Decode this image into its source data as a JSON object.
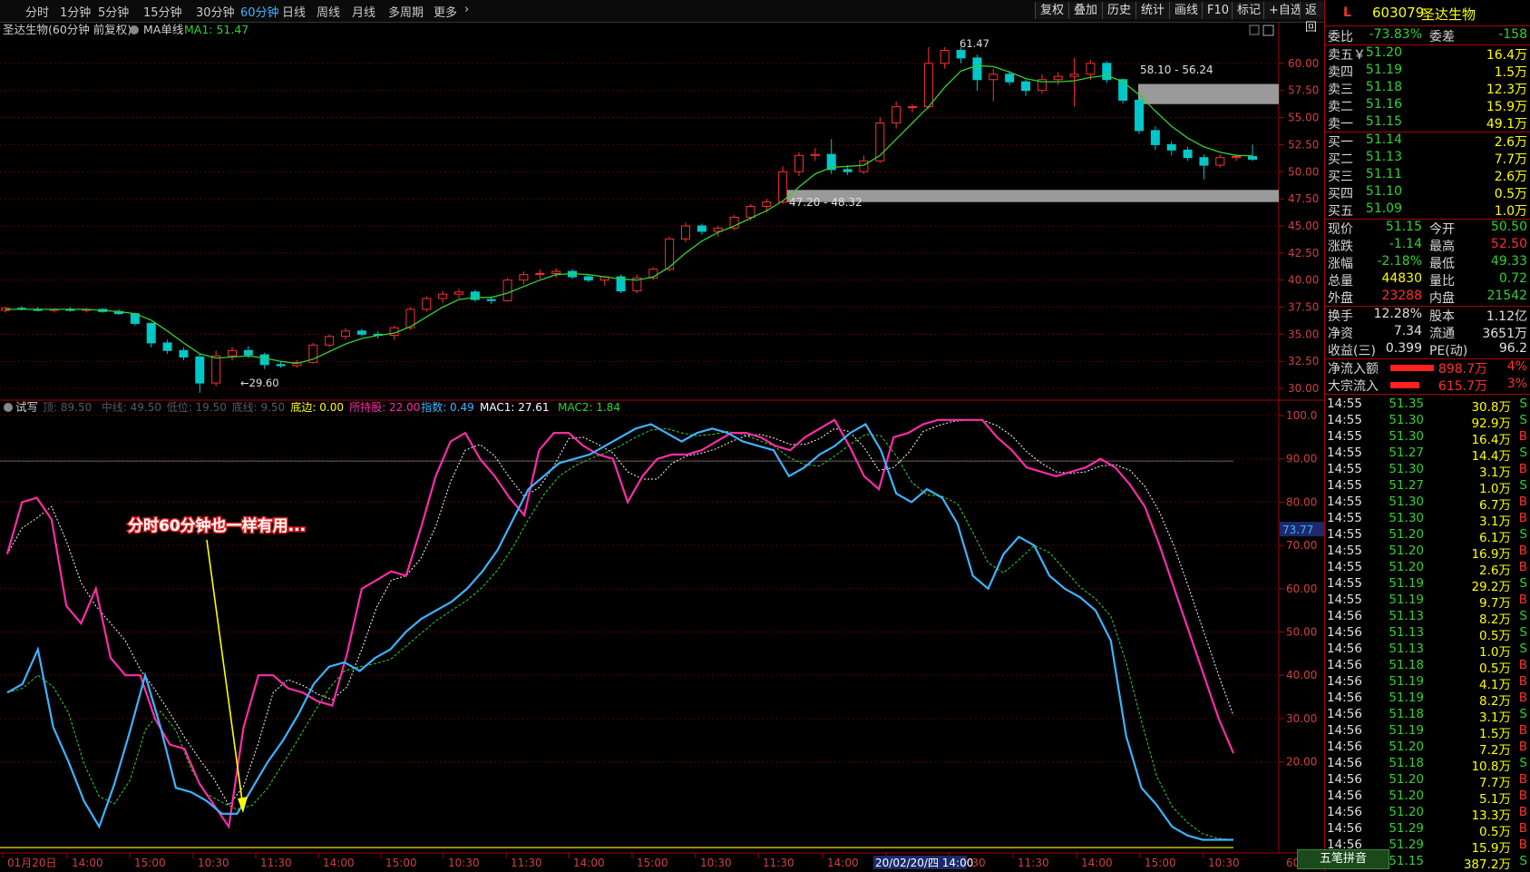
{
  "toolbar": {
    "periods": [
      "分时",
      "1分钟",
      "5分钟",
      "15分钟",
      "30分钟",
      "60分钟",
      "日线",
      "周线",
      "月线",
      "多周期",
      "更多"
    ],
    "active_period": "60分钟",
    "more_arrow": "›",
    "buttons": [
      "复权",
      "叠加",
      "历史",
      "统计",
      "画线",
      "F10",
      "标记",
      "+自选",
      "返回"
    ]
  },
  "main_chart": {
    "title": "圣达生物(60分钟 前复权)",
    "ma_label": "MA单线",
    "ma_value": "MA1: 51.47",
    "price_ticks": [
      "60.00",
      "57.50",
      "55.00",
      "52.50",
      "50.00",
      "47.50",
      "45.00",
      "42.50",
      "40.00",
      "37.50",
      "35.00",
      "32.50",
      "30.00"
    ],
    "high_label": "61.47",
    "low_label": "29.60",
    "zone_upper_label": "58.10 - 56.24",
    "zone_lower_label": "47.20 - 48.32"
  },
  "indicator": {
    "name": "试写",
    "legend": [
      {
        "label": "顶: 89.50",
        "color": "#5a5a5a"
      },
      {
        "label": "中线: 49.50",
        "color": "#5a5a5a"
      },
      {
        "label": "低位: 19.50",
        "color": "#5a5a5a"
      },
      {
        "label": "底线: 9.50",
        "color": "#5a5a5a"
      },
      {
        "label": "底边: 0.00",
        "color": "#ffff00"
      },
      {
        "label": "所持股: 22.00",
        "color": "#ff2ca8"
      },
      {
        "label": "指数: 0.49",
        "color": "#3db4ff"
      },
      {
        "label": "MAC1: 27.61",
        "color": "#ffffff"
      },
      {
        "label": "MAC2: 1.84",
        "color": "#32d232"
      }
    ],
    "ticks": [
      "100.0",
      "90.00",
      "80.00",
      "70.00",
      "60.00",
      "50.00",
      "40.00",
      "30.00",
      "20.00"
    ],
    "current_marker": "73.77",
    "annotation": "分时60分钟也一样有用..."
  },
  "time_axis": {
    "labels": [
      "01月20日",
      "14:00",
      "15:00",
      "10:30",
      "11:30",
      "14:00",
      "15:00",
      "10:30",
      "11:30",
      "14:00",
      "15:00",
      "10:30",
      "11:30",
      "14:00",
      "15:00",
      "10:30",
      "11:30",
      "14:00",
      "15:00",
      "10:30"
    ],
    "cursor_label": "20/02/20/四 14:00",
    "right_label": "60"
  },
  "quote": {
    "logo": "L",
    "code": "603079",
    "name": "圣达生物",
    "weibi_label": "委比",
    "weibi": "-73.83%",
    "weicha_label": "委差",
    "weicha": "-158",
    "asks": [
      {
        "label": "卖五￥",
        "price": "51.20",
        "vol": "16.4万"
      },
      {
        "label": "卖四",
        "price": "51.19",
        "vol": "1.5万"
      },
      {
        "label": "卖三",
        "price": "51.18",
        "vol": "12.3万"
      },
      {
        "label": "卖二",
        "price": "51.16",
        "vol": "15.9万"
      },
      {
        "label": "卖一",
        "price": "51.15",
        "vol": "49.1万"
      }
    ],
    "bids": [
      {
        "label": "买一",
        "price": "51.14",
        "vol": "2.6万"
      },
      {
        "label": "买二",
        "price": "51.13",
        "vol": "7.7万"
      },
      {
        "label": "买三",
        "price": "51.11",
        "vol": "2.6万"
      },
      {
        "label": "买四",
        "price": "51.10",
        "vol": "0.5万"
      },
      {
        "label": "买五",
        "price": "51.09",
        "vol": "1.0万"
      }
    ],
    "stats": [
      {
        "l1": "现价",
        "v1": "51.15",
        "c1": "g",
        "l2": "今开",
        "v2": "50.50",
        "c2": "g"
      },
      {
        "l1": "涨跌",
        "v1": "-1.14",
        "c1": "g",
        "l2": "最高",
        "v2": "52.50",
        "c2": "r"
      },
      {
        "l1": "涨幅",
        "v1": "-2.18%",
        "c1": "g",
        "l2": "最低",
        "v2": "49.33",
        "c2": "g"
      },
      {
        "l1": "总量",
        "v1": "44830",
        "c1": "y",
        "l2": "量比",
        "v2": "0.72",
        "c2": "g"
      },
      {
        "l1": "外盘",
        "v1": "23288",
        "c1": "r",
        "l2": "内盘",
        "v2": "21542",
        "c2": "g"
      }
    ],
    "stats2": [
      {
        "l1": "换手",
        "v1": "12.28%",
        "c1": "w",
        "l2": "股本",
        "v2": "1.12亿",
        "c2": "w"
      },
      {
        "l1": "净资",
        "v1": "7.34",
        "c1": "w",
        "l2": "流通",
        "v2": "3651万",
        "c2": "w"
      },
      {
        "l1": "收益(三)",
        "v1": "0.399",
        "c1": "w",
        "l2": "PE(动)",
        "v2": "96.2",
        "c2": "w"
      }
    ],
    "flows": [
      {
        "label": "净流入额",
        "value": "898.7万",
        "pct": "4%"
      },
      {
        "label": "大宗流入",
        "value": "615.7万",
        "pct": "3%"
      }
    ]
  },
  "ticks_list": [
    {
      "t": "14:55",
      "p": "51.35",
      "v": "30.8万",
      "s": "S"
    },
    {
      "t": "14:55",
      "p": "51.30",
      "v": "92.9万",
      "s": "S"
    },
    {
      "t": "14:55",
      "p": "51.30",
      "v": "16.4万",
      "s": "B"
    },
    {
      "t": "14:55",
      "p": "51.27",
      "v": "14.4万",
      "s": "S"
    },
    {
      "t": "14:55",
      "p": "51.30",
      "v": "3.1万",
      "s": "B"
    },
    {
      "t": "14:55",
      "p": "51.27",
      "v": "1.0万",
      "s": "S"
    },
    {
      "t": "14:55",
      "p": "51.30",
      "v": "6.7万",
      "s": "B"
    },
    {
      "t": "14:55",
      "p": "51.30",
      "v": "3.1万",
      "s": "B"
    },
    {
      "t": "14:55",
      "p": "51.20",
      "v": "6.1万",
      "s": "S"
    },
    {
      "t": "14:55",
      "p": "51.20",
      "v": "16.9万",
      "s": "B"
    },
    {
      "t": "14:55",
      "p": "51.20",
      "v": "2.6万",
      "s": "B"
    },
    {
      "t": "14:55",
      "p": "51.19",
      "v": "29.2万",
      "s": "S"
    },
    {
      "t": "14:55",
      "p": "51.19",
      "v": "9.7万",
      "s": "B"
    },
    {
      "t": "14:56",
      "p": "51.13",
      "v": "8.2万",
      "s": "S"
    },
    {
      "t": "14:56",
      "p": "51.13",
      "v": "0.5万",
      "s": "S"
    },
    {
      "t": "14:56",
      "p": "51.13",
      "v": "1.0万",
      "s": "S"
    },
    {
      "t": "14:56",
      "p": "51.18",
      "v": "0.5万",
      "s": "B"
    },
    {
      "t": "14:56",
      "p": "51.19",
      "v": "4.1万",
      "s": "B"
    },
    {
      "t": "14:56",
      "p": "51.19",
      "v": "8.2万",
      "s": "B"
    },
    {
      "t": "14:56",
      "p": "51.18",
      "v": "3.1万",
      "s": "S"
    },
    {
      "t": "14:56",
      "p": "51.19",
      "v": "1.5万",
      "s": "B"
    },
    {
      "t": "14:56",
      "p": "51.20",
      "v": "7.2万",
      "s": "B"
    },
    {
      "t": "14:56",
      "p": "51.18",
      "v": "10.8万",
      "s": "S"
    },
    {
      "t": "14:56",
      "p": "51.20",
      "v": "7.7万",
      "s": "B"
    },
    {
      "t": "14:56",
      "p": "51.20",
      "v": "5.1万",
      "s": "B"
    },
    {
      "t": "14:56",
      "p": "51.20",
      "v": "13.3万",
      "s": "B"
    },
    {
      "t": "14:56",
      "p": "51.29",
      "v": "0.5万",
      "s": "B"
    },
    {
      "t": "14:56",
      "p": "51.29",
      "v": "15.9万",
      "s": "B"
    },
    {
      "t": "14:56",
      "p": "51.15",
      "v": "387.2万",
      "s": "S"
    }
  ],
  "bottom_button": "五笔拼音",
  "chart_data": {
    "type": "candlestick",
    "candles": [
      [
        37.2,
        37.5,
        37.0,
        37.4
      ],
      [
        37.4,
        37.6,
        37.2,
        37.3
      ],
      [
        37.3,
        37.5,
        37.1,
        37.2
      ],
      [
        37.2,
        37.4,
        37.0,
        37.3
      ],
      [
        37.3,
        37.5,
        37.1,
        37.2
      ],
      [
        37.2,
        37.4,
        37.0,
        37.3
      ],
      [
        37.3,
        37.4,
        37.0,
        37.1
      ],
      [
        37.1,
        37.3,
        36.8,
        36.9
      ],
      [
        36.9,
        37.0,
        35.8,
        36.0
      ],
      [
        36.0,
        36.1,
        33.8,
        34.2
      ],
      [
        34.2,
        34.5,
        33.2,
        33.5
      ],
      [
        33.5,
        33.8,
        32.6,
        32.9
      ],
      [
        32.9,
        33.2,
        29.6,
        30.5
      ],
      [
        30.5,
        33.5,
        30.2,
        33.0
      ],
      [
        33.0,
        33.8,
        32.6,
        33.5
      ],
      [
        33.5,
        33.9,
        32.8,
        33.1
      ],
      [
        33.1,
        33.3,
        31.8,
        32.2
      ],
      [
        32.2,
        32.5,
        31.9,
        32.1
      ],
      [
        32.1,
        32.6,
        31.9,
        32.4
      ],
      [
        32.4,
        34.2,
        32.3,
        34.0
      ],
      [
        34.0,
        35.0,
        33.8,
        34.8
      ],
      [
        34.8,
        35.6,
        34.5,
        35.3
      ],
      [
        35.3,
        35.5,
        34.8,
        35.0
      ],
      [
        35.0,
        35.3,
        34.6,
        34.9
      ],
      [
        34.9,
        35.8,
        34.5,
        35.6
      ],
      [
        35.6,
        37.5,
        35.4,
        37.3
      ],
      [
        37.3,
        38.5,
        37.1,
        38.3
      ],
      [
        38.3,
        39.0,
        37.9,
        38.7
      ],
      [
        38.7,
        39.2,
        38.3,
        38.9
      ],
      [
        38.9,
        39.1,
        38.0,
        38.2
      ],
      [
        38.2,
        38.5,
        37.8,
        38.1
      ],
      [
        38.1,
        40.2,
        38.0,
        40.0
      ],
      [
        40.0,
        40.8,
        39.6,
        40.5
      ],
      [
        40.5,
        41.0,
        40.1,
        40.6
      ],
      [
        40.6,
        41.1,
        40.2,
        40.8
      ],
      [
        40.8,
        41.0,
        40.1,
        40.3
      ],
      [
        40.3,
        40.5,
        39.8,
        40.0
      ],
      [
        40.0,
        40.4,
        39.5,
        40.3
      ],
      [
        40.3,
        40.5,
        38.8,
        39.0
      ],
      [
        39.0,
        40.5,
        38.8,
        40.2
      ],
      [
        40.2,
        41.2,
        40.0,
        41.0
      ],
      [
        41.0,
        44.0,
        40.8,
        43.8
      ],
      [
        43.8,
        45.3,
        43.5,
        45.0
      ],
      [
        45.0,
        45.2,
        44.2,
        44.5
      ],
      [
        44.5,
        45.0,
        44.0,
        44.8
      ],
      [
        44.8,
        46.0,
        44.6,
        45.8
      ],
      [
        45.8,
        47.0,
        45.5,
        46.8
      ],
      [
        46.8,
        47.5,
        46.2,
        47.2
      ],
      [
        47.2,
        50.5,
        47.0,
        50.0
      ],
      [
        50.0,
        51.8,
        49.6,
        51.5
      ],
      [
        51.5,
        52.2,
        51.0,
        51.6
      ],
      [
        51.6,
        53.0,
        49.8,
        50.2
      ],
      [
        50.2,
        50.6,
        49.7,
        50.0
      ],
      [
        50.0,
        51.5,
        49.8,
        51.0
      ],
      [
        51.0,
        55.0,
        50.8,
        54.5
      ],
      [
        54.5,
        56.5,
        54.0,
        56.0
      ],
      [
        56.0,
        56.2,
        55.5,
        56.0
      ],
      [
        56.0,
        61.5,
        55.8,
        60.0
      ],
      [
        60.0,
        61.5,
        59.5,
        61.2
      ],
      [
        61.2,
        61.5,
        60.0,
        60.5
      ],
      [
        60.5,
        60.8,
        57.5,
        58.5
      ],
      [
        58.5,
        59.5,
        56.5,
        59.0
      ],
      [
        59.0,
        59.3,
        58.0,
        58.3
      ],
      [
        58.3,
        58.5,
        57.0,
        57.5
      ],
      [
        57.5,
        59.0,
        57.2,
        58.5
      ],
      [
        58.5,
        59.2,
        58.0,
        58.8
      ],
      [
        58.8,
        60.5,
        56.0,
        59.0
      ],
      [
        59.0,
        60.3,
        58.5,
        60.0
      ],
      [
        60.0,
        60.2,
        58.2,
        58.5
      ],
      [
        58.5,
        58.6,
        56.3,
        56.6
      ],
      [
        56.6,
        56.8,
        53.5,
        53.8
      ],
      [
        53.8,
        54.2,
        52.0,
        52.5
      ],
      [
        52.5,
        52.8,
        51.5,
        52.0
      ],
      [
        52.0,
        52.3,
        51.0,
        51.3
      ],
      [
        51.3,
        51.6,
        49.3,
        50.6
      ],
      [
        50.6,
        51.6,
        50.4,
        51.3
      ],
      [
        51.3,
        51.6,
        51.0,
        51.4
      ],
      [
        51.4,
        52.5,
        51.0,
        51.15
      ]
    ],
    "ma": [
      37.3,
      37.3,
      37.3,
      37.3,
      37.3,
      37.3,
      37.2,
      37.1,
      36.9,
      36.3,
      35.3,
      34.2,
      33.2,
      32.8,
      32.9,
      33.0,
      32.8,
      32.5,
      32.3,
      32.7,
      33.4,
      34.1,
      34.6,
      34.9,
      35.1,
      35.7,
      36.6,
      37.5,
      38.2,
      38.4,
      38.4,
      38.8,
      39.4,
      40.0,
      40.5,
      40.6,
      40.5,
      40.3,
      40.1,
      40.0,
      40.3,
      41.2,
      42.5,
      43.6,
      44.4,
      45.0,
      45.7,
      46.4,
      47.3,
      48.6,
      49.8,
      50.4,
      50.5,
      50.6,
      51.5,
      53.0,
      54.5,
      56.0,
      57.8,
      59.3,
      59.8,
      59.7,
      59.2,
      58.6,
      58.3,
      58.3,
      58.4,
      58.7,
      58.9,
      58.3,
      57.1,
      55.6,
      54.2,
      53.1,
      52.3,
      51.8,
      51.5,
      51.47
    ],
    "ylim": [
      29.0,
      62.5
    ],
    "zones": [
      [
        56.24,
        58.1
      ],
      [
        47.2,
        48.32
      ]
    ],
    "indicator_series": {
      "ylim": [
        0,
        100
      ],
      "pink": [
        68,
        80,
        81,
        76,
        56,
        52,
        60,
        44,
        40,
        40,
        30,
        24,
        23,
        15,
        10,
        5,
        28,
        40,
        40,
        37,
        36,
        34,
        33,
        45,
        60,
        62,
        64,
        63,
        74,
        86,
        94,
        96,
        90,
        86,
        81,
        77,
        92,
        96,
        96,
        93,
        91,
        90,
        80,
        86,
        90,
        91,
        91,
        92,
        94,
        96,
        96,
        95,
        93,
        92,
        95,
        97,
        99,
        93,
        86,
        83,
        95,
        96,
        98,
        99,
        99,
        99,
        99,
        95,
        92,
        88,
        87,
        86,
        87,
        88,
        90,
        88,
        84,
        79,
        70,
        60,
        50,
        40,
        30,
        22
      ],
      "blue": [
        36,
        38,
        46,
        28,
        20,
        11,
        5,
        15,
        27,
        40,
        28,
        14,
        13,
        11,
        8,
        8,
        14,
        20,
        25,
        31,
        38,
        42,
        43,
        41,
        44,
        46,
        50,
        53,
        55,
        57,
        60,
        64,
        69,
        76,
        83,
        86,
        89,
        90,
        91,
        93,
        95,
        97,
        98,
        96,
        94,
        96,
        97,
        96,
        94,
        93,
        92,
        86,
        88,
        91,
        93,
        96,
        98,
        92,
        82,
        80,
        83,
        81,
        75,
        63,
        60,
        68,
        72,
        70,
        63,
        60,
        58,
        55,
        48,
        26,
        14,
        10,
        5,
        3,
        2,
        2,
        2
      ]
    }
  }
}
